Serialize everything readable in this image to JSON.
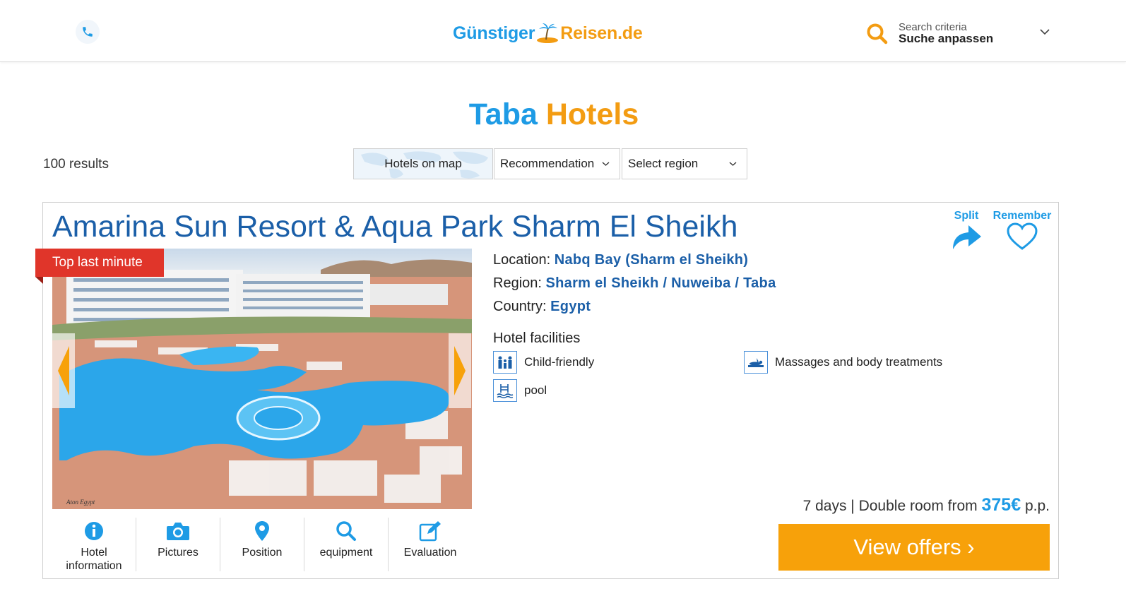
{
  "header": {
    "logo": {
      "part1": "Günstiger",
      "part2": "Reisen.de"
    },
    "search_criteria_label": "Search criteria",
    "search_criteria_value": "Suche anpassen"
  },
  "page_title": {
    "part1": "Taba",
    "part2": "Hotels"
  },
  "results_count": "100 results",
  "filters": {
    "map_button": "Hotels on map",
    "sort_select": "Recommendation",
    "region_select": "Select region"
  },
  "hotel": {
    "name": "Amarina Sun Resort & Aqua Park Sharm El Sheikh",
    "badge": "Top last minute",
    "split_label": "Split",
    "remember_label": "Remember",
    "location_label": "Location:",
    "location_value": "Nabq Bay (Sharm el Sheikh)",
    "region_label": "Region:",
    "region_value": "Sharm el Sheikh / Nuweiba / Taba",
    "country_label": "Country:",
    "country_value": "Egypt",
    "facilities_title": "Hotel facilities",
    "facilities": [
      {
        "label": "Child-friendly",
        "icon": "family-icon"
      },
      {
        "label": "Massages and body treatments",
        "icon": "massage-icon"
      },
      {
        "label": "pool",
        "icon": "pool-icon"
      }
    ],
    "tabs": [
      {
        "label": "Hotel information",
        "icon": "info-icon"
      },
      {
        "label": "Pictures",
        "icon": "camera-icon"
      },
      {
        "label": "Position",
        "icon": "map-pin-icon"
      },
      {
        "label": "equipment",
        "icon": "search-icon"
      },
      {
        "label": "Evaluation",
        "icon": "edit-icon"
      }
    ],
    "price_prefix": "7 days | Double room from",
    "price_amount": "375€",
    "price_suffix": "p.p.",
    "offers_button": "View offers ›"
  },
  "colors": {
    "brand_blue": "#1e9be5",
    "brand_orange": "#f39c12",
    "hotel_title": "#1b5fa8",
    "badge_red": "#e0352a",
    "offers_button": "#f7a10a"
  }
}
